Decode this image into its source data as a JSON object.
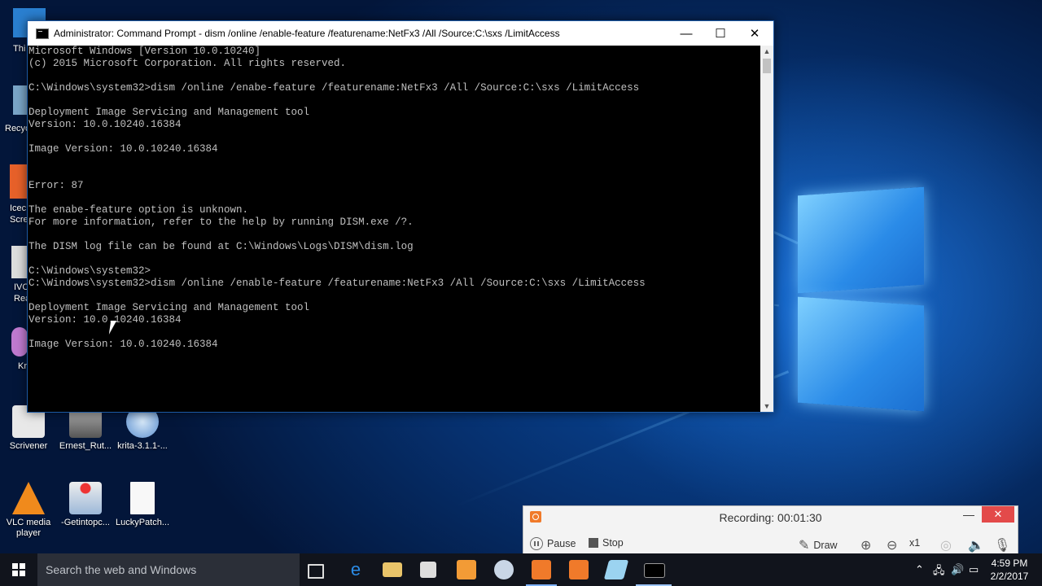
{
  "cmd": {
    "title": "Administrator: Command Prompt - dism  /online /enable-feature /featurename:NetFx3 /All /Source:C:\\sxs /LimitAccess",
    "minimize": "—",
    "maximize": "☐",
    "close": "✕",
    "output": "Microsoft Windows [Version 10.0.10240]\n(c) 2015 Microsoft Corporation. All rights reserved.\n\nC:\\Windows\\system32>dism /online /enabe-feature /featurename:NetFx3 /All /Source:C:\\sxs /LimitAccess\n\nDeployment Image Servicing and Management tool\nVersion: 10.0.10240.16384\n\nImage Version: 10.0.10240.16384\n\n\nError: 87\n\nThe enabe-feature option is unknown.\nFor more information, refer to the help by running DISM.exe /?.\n\nThe DISM log file can be found at C:\\Windows\\Logs\\DISM\\dism.log\n\nC:\\Windows\\system32>\nC:\\Windows\\system32>dism /online /enable-feature /featurename:NetFx3 /All /Source:C:\\sxs /LimitAccess\n\nDeployment Image Servicing and Management tool\nVersion: 10.0.10240.16384\n\nImage Version: 10.0.10240.16384"
  },
  "desktop": {
    "partial_labels": [
      "Thi",
      "Recyc",
      "Icec",
      "Scre",
      "IVC",
      "Rea",
      "Kr"
    ],
    "icons": [
      {
        "label": "Scrivener",
        "color": "#e8e8e8"
      },
      {
        "label": "Ernest_Rut...",
        "color": "#8a8a8a"
      },
      {
        "label": "krita-3.1.1-...",
        "color": "#6aa0d8"
      },
      {
        "label": "VLC media player",
        "color": "#f08a1c"
      },
      {
        "label": "-Getintopc...",
        "color": "#d8d8d8"
      },
      {
        "label": "LuckyPatch...",
        "color": "#f8f8f8"
      }
    ]
  },
  "recorder": {
    "status": "Recording:  00:01:30",
    "minimize": "—",
    "close": "✕",
    "pause": "Pause",
    "stop": "Stop",
    "draw": "Draw",
    "zoom": "x1"
  },
  "taskbar": {
    "search_placeholder": "Search the web and Windows",
    "time": "4:59 PM",
    "date": "2/2/2017",
    "colors": {
      "background": "#11141c",
      "search": "#2b2f38",
      "accent": "#7fb2ff"
    }
  }
}
